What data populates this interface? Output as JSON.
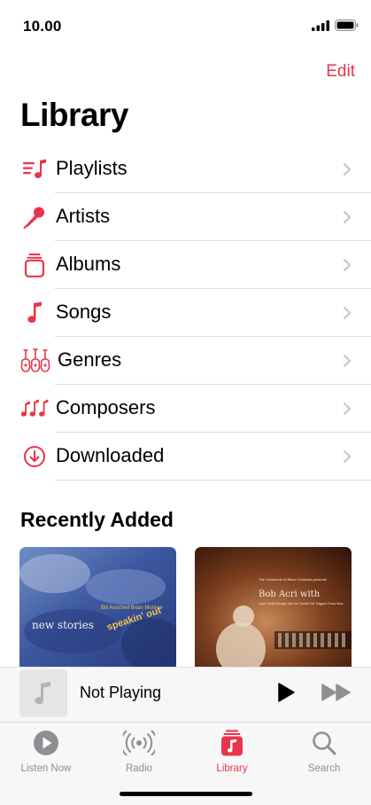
{
  "status_bar": {
    "time": "10.00"
  },
  "header": {
    "edit_label": "Edit",
    "title": "Library"
  },
  "library": {
    "items": [
      {
        "label": "Playlists",
        "icon": "playlists-icon"
      },
      {
        "label": "Artists",
        "icon": "microphone-icon"
      },
      {
        "label": "Albums",
        "icon": "album-stack-icon"
      },
      {
        "label": "Songs",
        "icon": "music-note-icon"
      },
      {
        "label": "Genres",
        "icon": "guitars-icon"
      },
      {
        "label": "Composers",
        "icon": "music-notes-icon"
      },
      {
        "label": "Downloaded",
        "icon": "download-circle-icon"
      }
    ]
  },
  "recently_added": {
    "title": "Recently Added",
    "albums": [
      {
        "cover_text_1": "new stories",
        "cover_text_2": "speakin' out",
        "cover_text_3": "Bill Anschell  Brian Monroe"
      },
      {
        "cover_text_1": "Bob Acri with",
        "cover_text_2": "The Cavalcade of Blues Guitarists presents",
        "cover_text_3": "Dave Smith  George Vaz  Joe Schaff  Jed Thigpen  Frank Woo"
      }
    ]
  },
  "mini_player": {
    "title": "Not Playing"
  },
  "tab_bar": {
    "tabs": [
      {
        "label": "Listen Now",
        "icon": "play-circle-icon"
      },
      {
        "label": "Radio",
        "icon": "radio-icon"
      },
      {
        "label": "Library",
        "icon": "library-icon"
      },
      {
        "label": "Search",
        "icon": "search-icon"
      }
    ],
    "active": "Library"
  },
  "colors": {
    "accent": "#e9344a",
    "inactive": "#8e8e93"
  }
}
